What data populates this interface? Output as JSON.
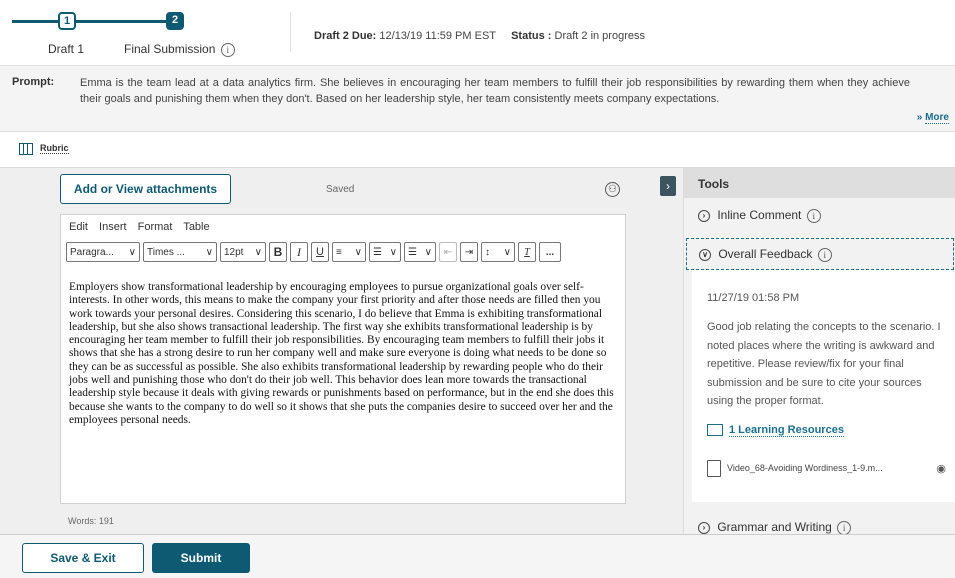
{
  "stepper": {
    "step1_number": "1",
    "step1_label": "Draft 1",
    "step2_number": "2",
    "step2_label": "Final Submission",
    "info_glyph": "i"
  },
  "header": {
    "due_label": "Draft 2 Due:",
    "due_value": "12/13/19  11:59 PM EST",
    "status_label": "Status :",
    "status_value": "Draft 2 in progress"
  },
  "prompt": {
    "label": "Prompt:",
    "text": "Emma is the team lead at a data analytics firm. She believes in encouraging her team members to fulfill their job responsibilities by rewarding them when they achieve their goals and punishing them when they don't. Based on her leadership style, her team consistently meets company expectations.",
    "more_label": "More",
    "more_icon": "double-chevron-down-icon"
  },
  "rubric": {
    "label": "Rubric"
  },
  "main": {
    "attach_button": "Add or View attachments",
    "saved_text": "Saved",
    "word_count": "Words: 191"
  },
  "editor": {
    "menu": [
      "Edit",
      "Insert",
      "Format",
      "Table"
    ],
    "paragraph_select": "Paragra...",
    "font_select": "Times ...",
    "size_select": "12pt",
    "bold": "B",
    "italic": "I",
    "underline": "U",
    "clear_format": "T",
    "more": "...",
    "body": "Employers show transformational leadership by encouraging employees to pursue organizational goals over self-interests. In other words, this means to make the company your first priority and after those needs are filled then you work towards your personal desires. Considering this scenario, I do believe that Emma is exhibiting transformational leadership, but she also shows transactional leadership. The first way she exhibits transformational leadership is by encouraging her team member to fulfill their job responsibilities. By encouraging team members to fulfill their jobs it shows that she has a strong desire to run her company well and make sure everyone is doing what needs to be done so they can be as successful as possible. She also exhibits transformational leadership by rewarding people who do their jobs well and punishing those who don't do their job well. This behavior does lean more towards the transactional leadership style because it deals with giving rewards or punishments based on performance, but in the end she does this because she wants to the company to do well so it shows that she puts the companies desire to succeed over her and the employees personal needs."
  },
  "tools": {
    "title": "Tools",
    "inline_comment": "Inline Comment",
    "overall_feedback": "Overall Feedback",
    "feedback_date": "11/27/19  01:58 PM",
    "feedback_text": "Good job relating the concepts to the scenario. I noted places where the writing is awkward and repetitive. Please review/fix for your final submission and be sure to cite your sources using the proper format.",
    "learning_resources": "1 Learning Resources",
    "video_name": "Video_68-Avoiding Wordiness_1-9.m...",
    "grammar": "Grammar and Writing"
  },
  "footer": {
    "save_exit": "Save & Exit",
    "submit": "Submit"
  },
  "colors": {
    "brand": "#0e5a73",
    "link": "#1a6e8e"
  }
}
